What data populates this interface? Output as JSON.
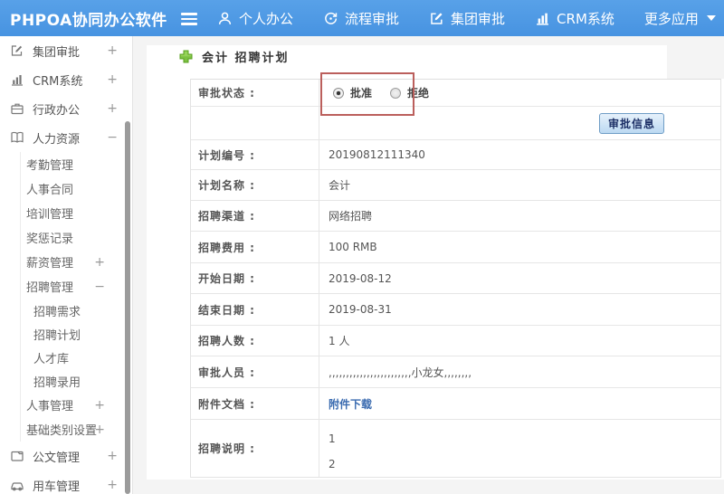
{
  "header": {
    "logo": "PHPOA协同办公软件",
    "nav": [
      {
        "label": "个人办公",
        "icon": "user-icon"
      },
      {
        "label": "流程审批",
        "icon": "cycle-icon"
      },
      {
        "label": "集团审批",
        "icon": "edit-icon"
      },
      {
        "label": "CRM系统",
        "icon": "bar-chart-icon"
      },
      {
        "label": "更多应用",
        "icon": "caret-down-icon"
      }
    ]
  },
  "sidebar": {
    "items": [
      {
        "label": "集团审批",
        "icon": "edit-square-icon",
        "toggle": "+",
        "level": 0
      },
      {
        "label": "CRM系统",
        "icon": "bar-chart-icon",
        "toggle": "+",
        "level": 0
      },
      {
        "label": "行政办公",
        "icon": "briefcase-icon",
        "toggle": "+",
        "level": 0
      },
      {
        "label": "人力资源",
        "icon": "book-icon",
        "toggle": "−",
        "level": 0
      },
      {
        "label": "考勤管理",
        "level": 1
      },
      {
        "label": "人事合同",
        "level": 1
      },
      {
        "label": "培训管理",
        "level": 1
      },
      {
        "label": "奖惩记录",
        "level": 1
      },
      {
        "label": "薪资管理",
        "toggle": "+",
        "level": 1
      },
      {
        "label": "招聘管理",
        "toggle": "−",
        "level": 1
      },
      {
        "label": "招聘需求",
        "level": 2
      },
      {
        "label": "招聘计划",
        "level": 2
      },
      {
        "label": "人才库",
        "level": 2
      },
      {
        "label": "招聘录用",
        "level": 2
      },
      {
        "label": "人事管理",
        "toggle": "+",
        "level": 1
      },
      {
        "label": "基础类别设置",
        "toggle": "+",
        "level": 1
      },
      {
        "label": "公文管理",
        "icon": "folder-icon",
        "toggle": "+",
        "level": 0
      },
      {
        "label": "用车管理",
        "icon": "car-icon",
        "toggle": "+",
        "level": 0
      }
    ]
  },
  "main": {
    "title": "会计 招聘计划",
    "status_row": {
      "label": "审批状态 :",
      "approve": "批准",
      "reject": "拒绝",
      "selected": "批准"
    },
    "approve_button": "审批信息",
    "rows": [
      {
        "label": "计划编号 :",
        "value": "20190812111340"
      },
      {
        "label": "计划名称 :",
        "value": "会计"
      },
      {
        "label": "招聘渠道 :",
        "value": "网络招聘"
      },
      {
        "label": "招聘费用 :",
        "value": "100 RMB"
      },
      {
        "label": "开始日期 :",
        "value": "2019-08-12"
      },
      {
        "label": "结束日期 :",
        "value": "2019-08-31"
      },
      {
        "label": "招聘人数 :",
        "value": "1 人"
      },
      {
        "label": "审批人员 :",
        "value": ",,,,,,,,,,,,,,,,,,,,,,,,小龙女,,,,,,,,"
      }
    ],
    "attachment_row": {
      "label": "附件文档 :",
      "link": "附件下载"
    },
    "description_row": {
      "label": "招聘说明 :",
      "line1": "1",
      "line2": "2"
    }
  },
  "colors": {
    "header_blue": "#4793e1",
    "highlight_red": "#bb5f5c",
    "link_blue": "#3a6bb0",
    "plus_green": "#6cb52d",
    "background_gray": "#f4f4f4"
  }
}
